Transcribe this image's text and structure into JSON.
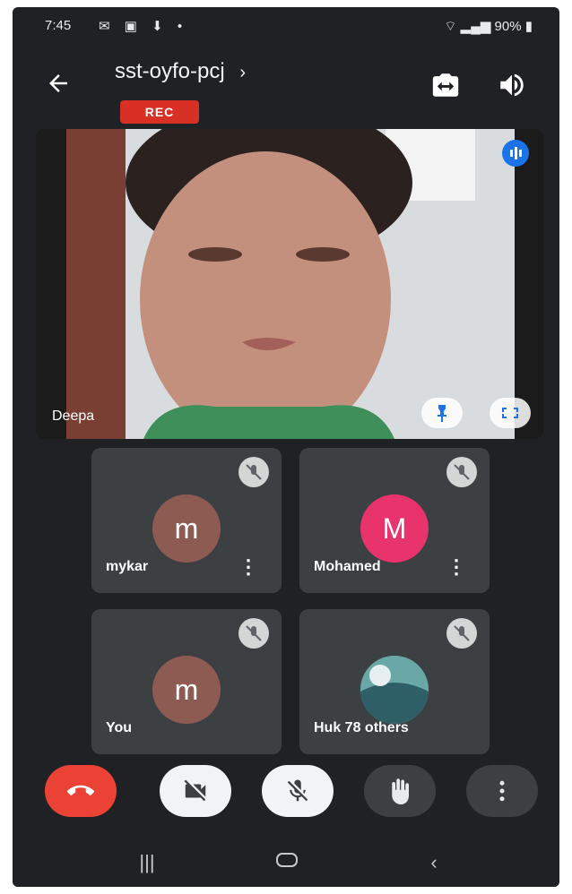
{
  "status_bar": {
    "time": "7:45",
    "left_icons": [
      "message-icon",
      "gallery-icon",
      "download-icon",
      "dot-icon"
    ],
    "battery": "90%",
    "right_icons": [
      "wifi-icon",
      "signal-icon",
      "battery-icon"
    ]
  },
  "header": {
    "meeting_code": "sst-oyfo-pcj",
    "rec_label": "REC",
    "icons": [
      "back-arrow-icon",
      "switch-camera-icon",
      "speaker-icon"
    ]
  },
  "main_video": {
    "participant_name": "Deepa",
    "icons": [
      "audio-active-icon",
      "pin-icon",
      "fullscreen-icon"
    ]
  },
  "tiles": [
    {
      "name": "mykar",
      "avatar_letter": "m",
      "avatar_color": "#8d5b52",
      "muted": true,
      "has_menu": true
    },
    {
      "name": "Mohamed",
      "avatar_letter": "M",
      "avatar_color": "#e8336d",
      "muted": true,
      "has_menu": true
    },
    {
      "name": "You",
      "avatar_letter": "m",
      "avatar_color": "#8d5b52",
      "muted": true,
      "has_menu": false
    },
    {
      "name": "Huk 78 others",
      "avatar_letter": "",
      "avatar_color": "#4a8a8f",
      "muted": true,
      "has_menu": false
    }
  ],
  "controls": [
    "end-call-icon",
    "camera-off-icon",
    "mic-off-icon",
    "raise-hand-icon",
    "more-options-icon"
  ],
  "colors": {
    "background": "#202124",
    "tile": "#3c4043",
    "end_call": "#ea4335",
    "rec": "#d93025",
    "accent": "#1a73e8"
  },
  "nav_bar": [
    "recents-icon",
    "home-icon",
    "back-icon"
  ]
}
